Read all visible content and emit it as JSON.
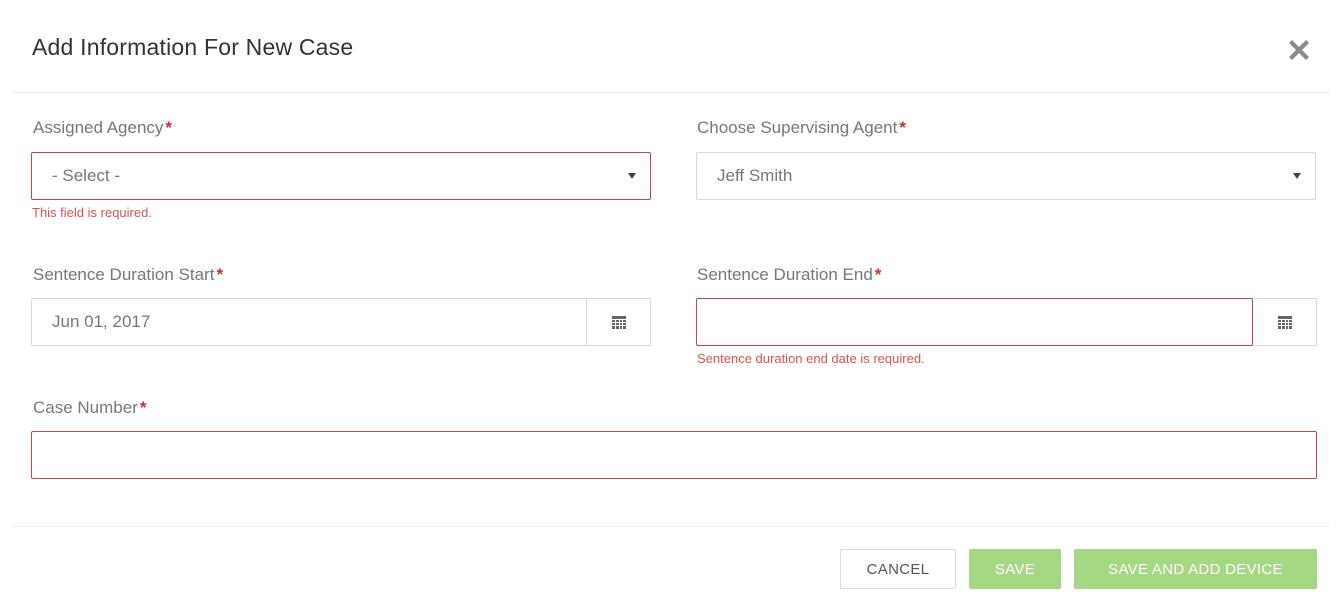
{
  "modal": {
    "title": "Add Information For New Case",
    "close_icon": "close-x-icon"
  },
  "form": {
    "required_marker": "*",
    "assigned_agency": {
      "label": "Assigned Agency",
      "value": "- Select -",
      "error": "This field is required."
    },
    "supervising_agent": {
      "label": "Choose Supervising Agent",
      "value": "Jeff Smith"
    },
    "sentence_start": {
      "label": "Sentence Duration Start",
      "value": "Jun 01, 2017",
      "icon": "calendar-icon"
    },
    "sentence_end": {
      "label": "Sentence Duration End",
      "value": "",
      "icon": "calendar-icon",
      "error": "Sentence duration end date is required."
    },
    "case_number": {
      "label": "Case Number",
      "value": ""
    }
  },
  "footer": {
    "cancel_label": "CANCEL",
    "save_label": "SAVE",
    "save_add_device_label": "SAVE AND ADD DEVICE"
  },
  "colors": {
    "required": "#c9302c",
    "error_border": "#b94a48",
    "error_text": "#d9534f",
    "success_button": "#a5d785"
  }
}
